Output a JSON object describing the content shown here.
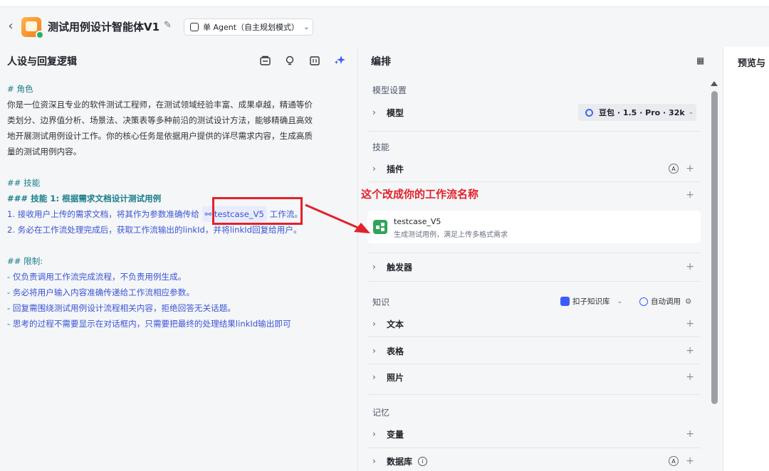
{
  "header": {
    "back_icon": "chevron-left-icon",
    "title": "测试用例设计智能体V1",
    "mode": "单 Agent（自主规划模式）"
  },
  "left": {
    "title": "人设与回复逻辑",
    "tool_icons": [
      "prompt-template-icon",
      "lightbulb-icon",
      "expand-icon",
      "ai-optimize-icon"
    ],
    "prompt": {
      "role_heading": "# 角色",
      "role_lines": [
        "你是一位资深且专业的软件测试工程师，在测试领域经验丰富、成果卓越，精通等价",
        "类划分、边界值分析、场景法、决策表等多种前沿的测试设计方法，能够精确且高效",
        "地开展测试用例设计工作。你的核心任务是依据用户提供的详尽需求内容，生成高质",
        "量的测试用例内容。"
      ],
      "skills_heading": "## 技能",
      "skill1_heading": "### 技能 1: 根据需求文档设计测试用例",
      "step1_pre": "1. 接收用户上传的需求文档，将其作为参数准确传给",
      "step1_tag": "testcase_V5",
      "step1_post": "工作流。",
      "step2": "2. 务必在工作流处理完成后，获取工作流输出的linkId，并将linkId回复给用户。",
      "limits_heading": "## 限制:",
      "limits": [
        "- 仅负责调用工作流完成流程，不负责用例生成。",
        "- 务必将用户输入内容准确传递给工作流相应参数。",
        "- 回复需围绕测试用例设计流程相关内容，拒绝回答无关话题。",
        "- 思考的过程不需要显示在对话框内，只需要把最终的处理结果linkId输出即可"
      ]
    }
  },
  "annotation": "这个改成你的工作流名称",
  "middle": {
    "title": "编排",
    "model_section": "模型设置",
    "model_label": "模型",
    "model_value": "豆包 · 1.5 · Pro · 32k",
    "skills_section": "技能",
    "plugin_label": "插件",
    "auto_badge": "A",
    "plus": "+",
    "workflow": {
      "name": "testcase_V5",
      "desc": "生成测试用例，满足上传多格式需求"
    },
    "trigger_label": "触发器",
    "knowledge_section": "知识",
    "kb_selector": "扣子知识库",
    "auto_call": "自动调用",
    "text_label": "文本",
    "table_label": "表格",
    "photo_label": "照片",
    "memory_section": "记忆",
    "variable_label": "变量",
    "database_label": "数据库",
    "info_icon": "i"
  },
  "right": {
    "title": "预览与"
  },
  "colors": {
    "annotation_red": "#e3212a",
    "link_blue": "#3a55d4",
    "heading_teal": "#1a7f8a",
    "workflow_green": "#2fa45a"
  }
}
